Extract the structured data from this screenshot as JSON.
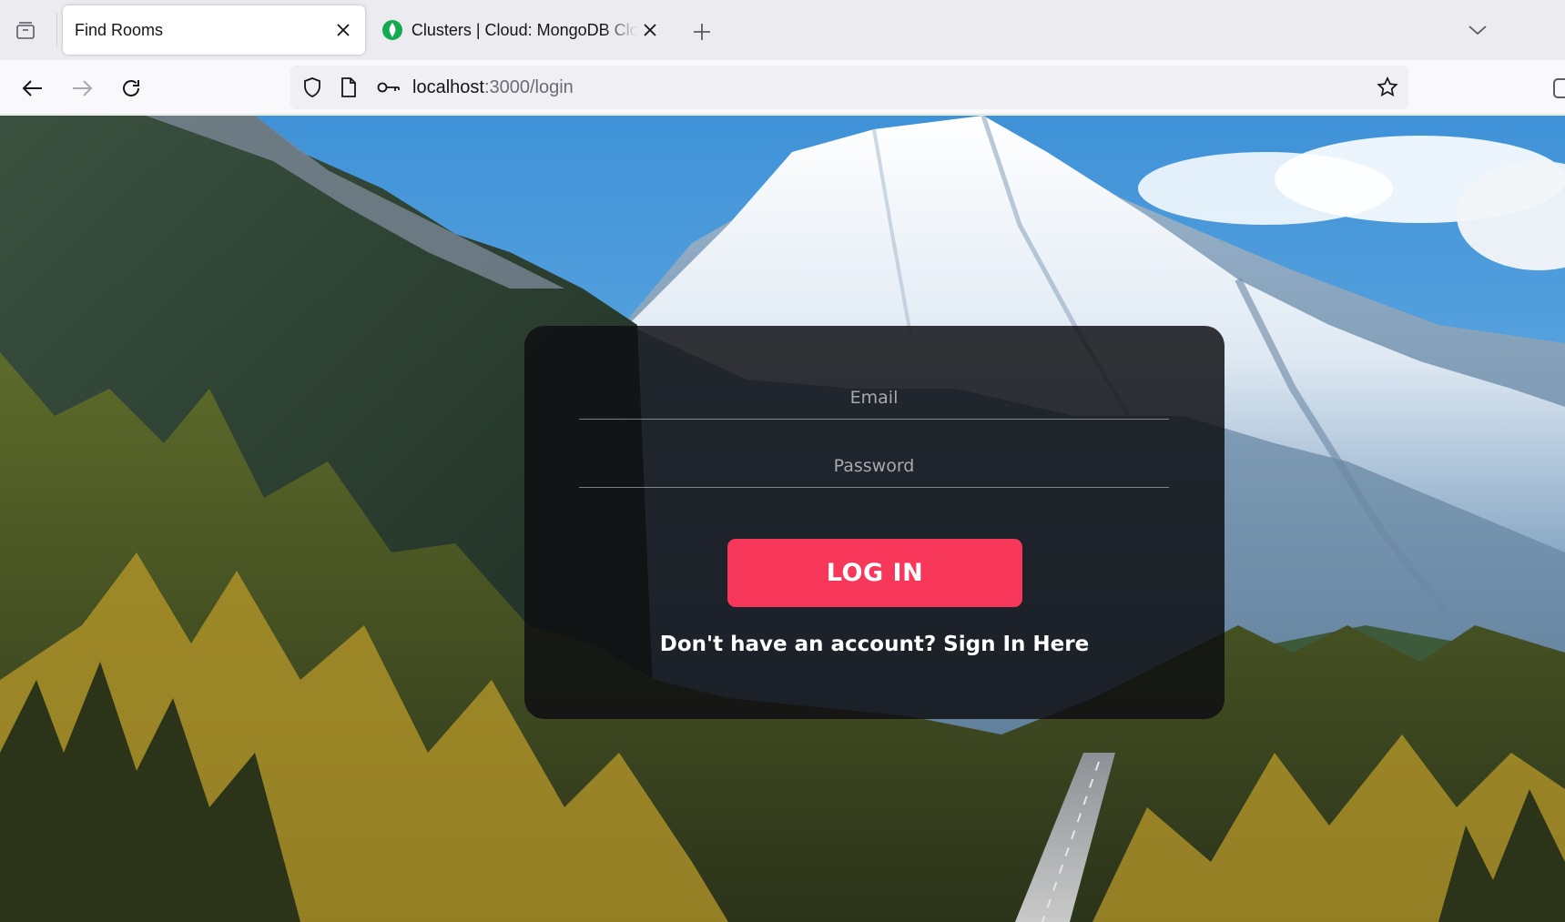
{
  "browser": {
    "tabs": [
      {
        "title": "Find Rooms",
        "active": true
      },
      {
        "title": "Clusters | Cloud: MongoDB Cloud",
        "active": false,
        "favicon": "mongodb-leaf-icon"
      }
    ],
    "address": {
      "host": "localhost",
      "path": ":3000/login"
    },
    "icons": {
      "tab_manager": "tab-manager-icon",
      "new_tab": "plus-icon",
      "tabs_list": "chevron-down-icon",
      "back": "back-arrow-icon",
      "forward": "forward-arrow-icon",
      "reload": "reload-icon",
      "security": "shield-icon",
      "page_info": "page-icon",
      "passwords": "key-icon",
      "bookmark": "star-icon"
    }
  },
  "login": {
    "email_placeholder": "Email",
    "password_placeholder": "Password",
    "login_button": "LOG IN",
    "signup_link": "Don't have an account? Sign In Here"
  },
  "colors": {
    "accent": "#f7375a",
    "card_bg": "rgba(14,14,18,0.84)",
    "tabbar_bg": "#ecebf0",
    "toolbar_bg": "#f9f9fb"
  }
}
